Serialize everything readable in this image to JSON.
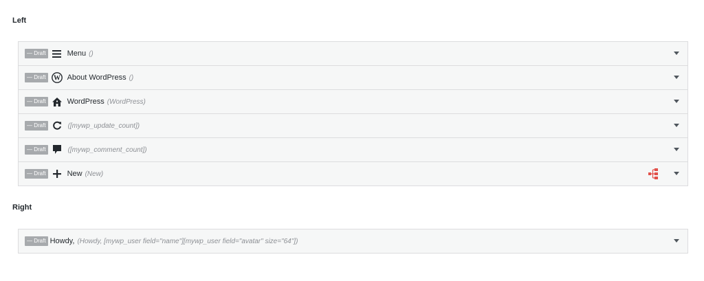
{
  "sections": {
    "left_title": "Left",
    "right_title": "Right"
  },
  "badge": "— Draft",
  "left_items": [
    {
      "icon": "menu-icon",
      "title": "Menu",
      "sub": "()"
    },
    {
      "icon": "wordpress-icon",
      "title": "About WordPress",
      "sub": "()"
    },
    {
      "icon": "home-icon",
      "title": "WordPress",
      "sub": "(WordPress)"
    },
    {
      "icon": "refresh-icon",
      "title": "",
      "sub": "([mywp_update_count])"
    },
    {
      "icon": "comment-icon",
      "title": "",
      "sub": "([mywp_comment_count])"
    },
    {
      "icon": "plus-icon",
      "title": "New",
      "sub": "(New)"
    }
  ],
  "right_items": [
    {
      "title": "Howdy,",
      "sub": "(Howdy, [mywp_user field=\"name\"][mywp_user field=\"avatar\" size=\"64\"])"
    }
  ],
  "colors": {
    "sitemap_icon": "#e2504a",
    "badge_bg": "#a7aaad"
  }
}
